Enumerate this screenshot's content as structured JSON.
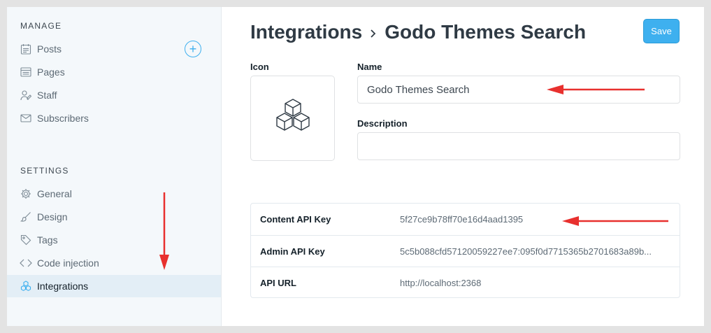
{
  "sidebar": {
    "manage_title": "MANAGE",
    "manage_items": [
      {
        "label": "Posts",
        "icon": "posts-icon"
      },
      {
        "label": "Pages",
        "icon": "pages-icon"
      },
      {
        "label": "Staff",
        "icon": "staff-icon"
      },
      {
        "label": "Subscribers",
        "icon": "subscribers-icon"
      }
    ],
    "settings_title": "SETTINGS",
    "settings_items": [
      {
        "label": "General",
        "icon": "gear-icon"
      },
      {
        "label": "Design",
        "icon": "brush-icon"
      },
      {
        "label": "Tags",
        "icon": "tag-icon"
      },
      {
        "label": "Code injection",
        "icon": "code-icon"
      },
      {
        "label": "Integrations",
        "icon": "integrations-icon",
        "active": true
      }
    ],
    "add_post_icon": "plus-circle-icon"
  },
  "header": {
    "breadcrumb_parent": "Integrations",
    "breadcrumb_separator": ">",
    "breadcrumb_current": "Godo Themes Search",
    "save_label": "Save"
  },
  "form": {
    "icon_label": "Icon",
    "icon_name": "cubes-icon",
    "name_label": "Name",
    "name_value": "Godo Themes Search",
    "description_label": "Description",
    "description_value": ""
  },
  "api": {
    "rows": [
      {
        "key": "Content API Key",
        "value": "5f27ce9b78ff70e16d4aad1395"
      },
      {
        "key": "Admin API Key",
        "value": "5c5b088cfd57120059227ee7:095f0d7715365b2701683a89b..."
      },
      {
        "key": "API URL",
        "value": "http://localhost:2368"
      }
    ]
  },
  "colors": {
    "accent": "#3eb0ef",
    "sidebar_bg": "#f4f8fb",
    "active_bg": "#e3eef6",
    "annotation": "#e8302e"
  }
}
